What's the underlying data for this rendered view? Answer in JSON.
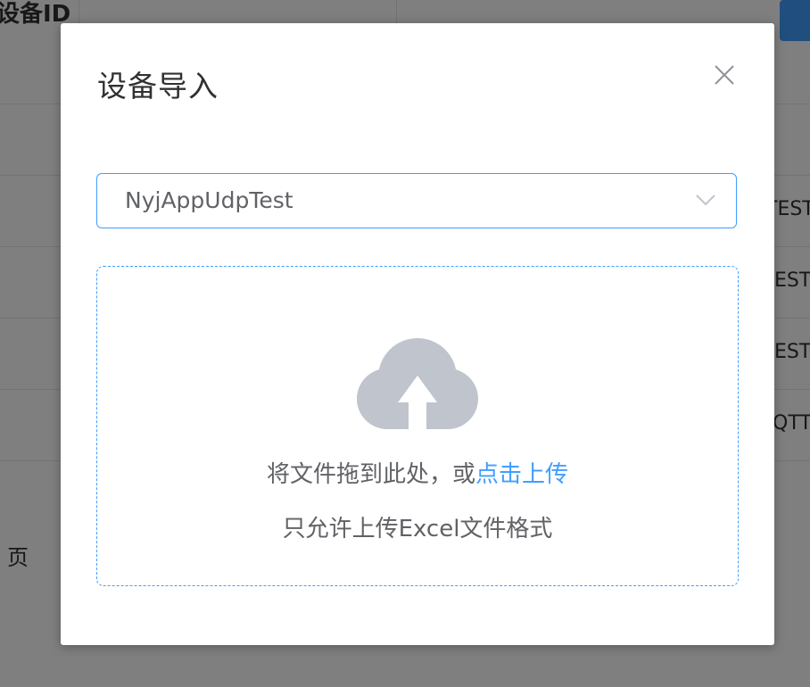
{
  "background": {
    "header_label": "设备ID",
    "right_cells": [
      "TEST",
      "EST",
      "EST",
      "QTT"
    ],
    "pagination_text": "页"
  },
  "dialog": {
    "title": "设备导入",
    "close_icon": "close-icon",
    "select": {
      "value": "NyjAppUdpTest",
      "arrow_icon": "chevron-down-icon"
    },
    "upload": {
      "icon": "cloud-upload-icon",
      "hint_text": "将文件拖到此处，或",
      "hint_link": "点击上传",
      "tip": "只允许上传Excel文件格式"
    }
  },
  "colors": {
    "primary": "#409eff",
    "text_primary": "#303133",
    "text_regular": "#606266",
    "icon_gray": "#c0c4cc"
  }
}
